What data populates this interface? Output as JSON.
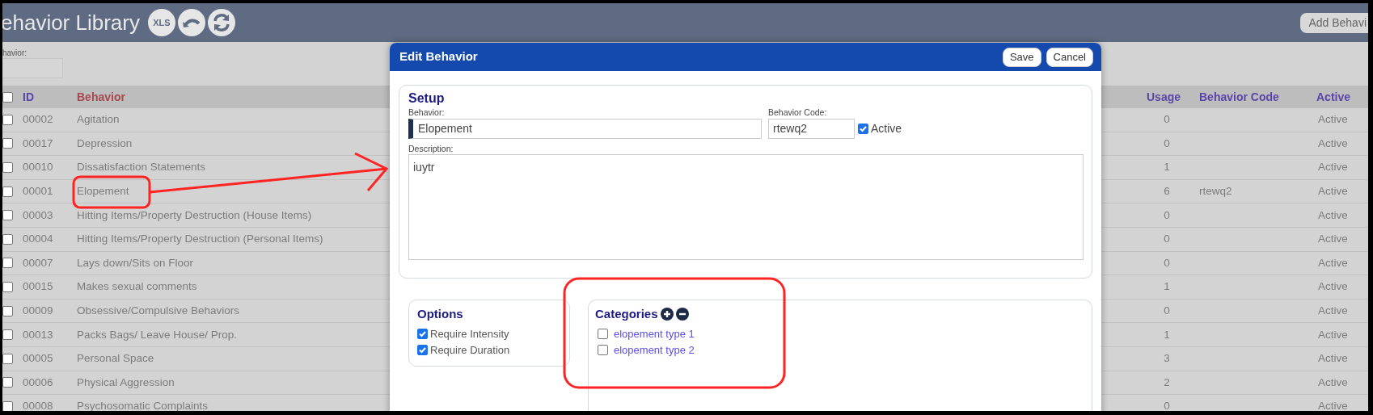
{
  "header": {
    "title": "ehavior Library",
    "xls": "XLS",
    "add_button": "Add Behavi"
  },
  "filter": {
    "label": "havior:"
  },
  "table": {
    "all_checked": false,
    "columns": [
      "ID",
      "Behavior",
      "Usage",
      "Behavior Code",
      "Active"
    ],
    "rows": [
      {
        "checked": false,
        "id": "00002",
        "behavior": "Agitation",
        "usage": "0",
        "code": "",
        "active": "Active"
      },
      {
        "checked": false,
        "id": "00017",
        "behavior": "Depression",
        "usage": "0",
        "code": "",
        "active": "Active"
      },
      {
        "checked": false,
        "id": "00010",
        "behavior": "Dissatisfaction Statements",
        "usage": "1",
        "code": "",
        "active": "Active"
      },
      {
        "checked": false,
        "id": "00001",
        "behavior": "Elopement",
        "usage": "6",
        "code": "rtewq2",
        "active": "Active"
      },
      {
        "checked": false,
        "id": "00003",
        "behavior": "Hitting Items/Property Destruction (House Items)",
        "usage": "0",
        "code": "",
        "active": "Active"
      },
      {
        "checked": false,
        "id": "00004",
        "behavior": "Hitting Items/Property Destruction (Personal Items)",
        "usage": "0",
        "code": "",
        "active": "Active"
      },
      {
        "checked": false,
        "id": "00007",
        "behavior": "Lays down/Sits on Floor",
        "usage": "0",
        "code": "",
        "active": "Active"
      },
      {
        "checked": false,
        "id": "00015",
        "behavior": "Makes sexual comments",
        "usage": "1",
        "code": "",
        "active": "Active"
      },
      {
        "checked": false,
        "id": "00009",
        "behavior": "Obsessive/Compulsive Behaviors",
        "usage": "0",
        "code": "",
        "active": "Active"
      },
      {
        "checked": false,
        "id": "00013",
        "behavior": "Packs Bags/ Leave House/ Prop.",
        "usage": "1",
        "code": "",
        "active": "Active"
      },
      {
        "checked": false,
        "id": "00005",
        "behavior": "Personal Space",
        "usage": "3",
        "code": "",
        "active": "Active"
      },
      {
        "checked": false,
        "id": "00006",
        "behavior": "Physical Aggression",
        "usage": "2",
        "code": "",
        "active": "Active"
      },
      {
        "checked": false,
        "id": "00008",
        "behavior": "Psychosomatic Complaints",
        "usage": "0",
        "code": "",
        "active": "Active"
      }
    ]
  },
  "modal": {
    "title": "Edit Behavior",
    "buttons": [
      "Save",
      "Cancel"
    ],
    "setup": {
      "title": "Setup",
      "behavior_label": "Behavior:",
      "behavior_value": "Elopement",
      "code_label": "Behavior Code:",
      "code_value": "rtewq2",
      "active_label": "Active",
      "active_checked": true,
      "description_label": "Description:",
      "description_value": "iuytr"
    },
    "options": {
      "title": "Options",
      "items": [
        {
          "label": "Require Intensity",
          "checked": true
        },
        {
          "label": "Require Duration",
          "checked": true
        }
      ]
    },
    "categories": {
      "title": "Categories",
      "items": [
        {
          "label": "elopement type 1",
          "checked": false
        },
        {
          "label": "elopement type 2",
          "checked": false
        }
      ]
    }
  }
}
